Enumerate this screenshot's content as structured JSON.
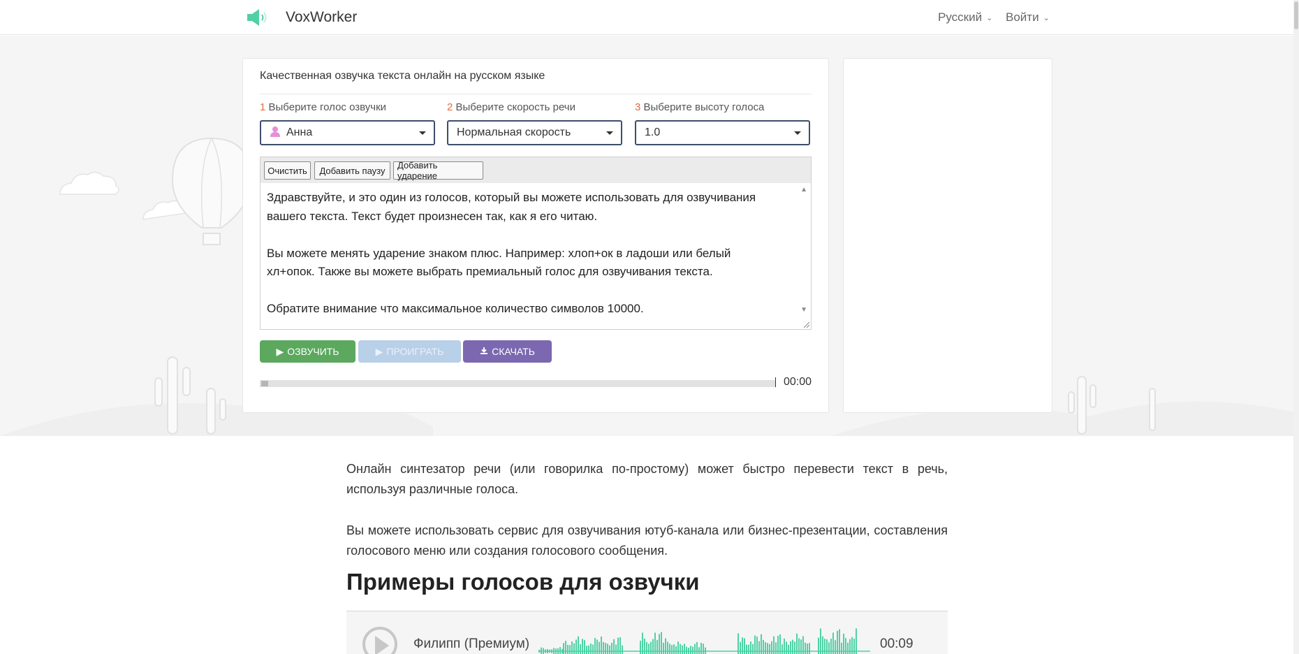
{
  "header": {
    "brand": "VoxWorker",
    "language": "Русский",
    "login": "Войти"
  },
  "tts": {
    "title": "Качественная озвучка текста онлайн на русском языке",
    "steps": [
      {
        "num": "1",
        "label": "Выберите голос озвучки",
        "value": "Анна"
      },
      {
        "num": "2",
        "label": "Выберите скорость речи",
        "value": "Нормальная скорость"
      },
      {
        "num": "3",
        "label": "Выберите высоту голоса",
        "value": "1.0"
      }
    ],
    "toolbar": {
      "clear": "Очистить",
      "add_pause": "Добавить паузу",
      "add_stress": "Добавить ударение"
    },
    "text_lines": [
      "Здравствуйте, и это один из голосов, который вы можете использовать для озвучивания",
      "вашего текста. Текст будет произнесен так, как я его читаю.",
      "Вы можете менять ударение знаком плюс. Например: хлоп+ок в ладоши или белый",
      "хл+опок. Также вы можете выбрать премиальный голос для озвучивания текста.",
      "Обратите внимание что максимальное количество символов 10000."
    ],
    "buttons": {
      "speak": "ОЗВУЧИТЬ",
      "play": "ПРОИГРАТЬ",
      "download": "СКАЧАТЬ"
    },
    "player_time": "00:00"
  },
  "article": {
    "paragraph1": "Онлайн синтезатор речи (или говорилка по-простому) может быстро перевести текст в речь, используя различные голоса.",
    "paragraph2": "Вы можете использовать сервис для озвучивания ютуб-канала или бизнес-презентации, составления голосового меню или создания голосового сообщения.",
    "samples_heading": "Примеры голосов для озвучки",
    "samples": [
      {
        "name": "Филипп (Премиум)",
        "duration": "00:09"
      }
    ]
  },
  "colors": {
    "accent_green": "#5ba85e",
    "accent_purple": "#7b68b0",
    "play_disabled": "#b8d0e8",
    "step_number": "#e8693c",
    "wave": "#4fd1a5",
    "logo": "#4fd1a5"
  },
  "icons": {
    "logo": "speaker-icon",
    "voice": "user-icon",
    "speak": "play-icon",
    "play": "play-icon",
    "download": "download-icon"
  }
}
